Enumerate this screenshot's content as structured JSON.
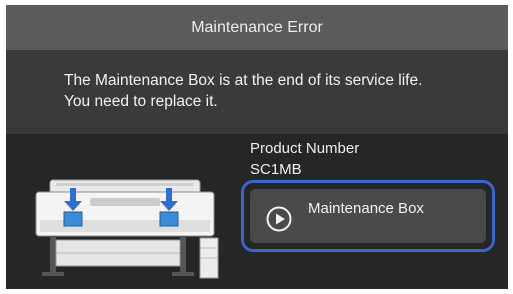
{
  "dialog": {
    "title": "Maintenance Error",
    "message_line1": "The Maintenance Box is at the end of its service life.",
    "message_line2": "You need to replace it."
  },
  "product": {
    "label": "Product Number",
    "value": "SC1MB"
  },
  "actions": {
    "maintenance_box_label": "Maintenance Box",
    "icon": "play-circle-icon"
  },
  "illustration": {
    "name": "printer-illustration",
    "arrow_color": "#2f6fd1"
  },
  "colors": {
    "titlebar": "#5b5b5b",
    "message_bg": "#3a3a3a",
    "lower_bg": "#262626",
    "button_bg": "#4a4a4a",
    "focus_border": "#3b66c9"
  }
}
